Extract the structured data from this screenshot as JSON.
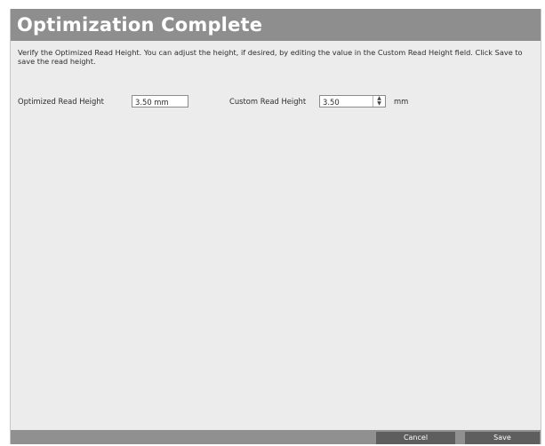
{
  "dialog": {
    "title": "Optimization Complete",
    "instructions": "Verify the Optimized Read Height. You can adjust the height, if desired, by editing the value in the Custom Read Height field. Click Save to save the read height."
  },
  "fields": {
    "optimized_label": "Optimized Read Height",
    "optimized_value": "3.50 mm",
    "custom_label": "Custom Read Height",
    "custom_value": "3.50",
    "custom_unit": "mm"
  },
  "buttons": {
    "cancel": "Cancel",
    "save": "Save"
  },
  "icons": {
    "spin_up": "spin-up-icon",
    "spin_down": "spin-down-icon"
  }
}
